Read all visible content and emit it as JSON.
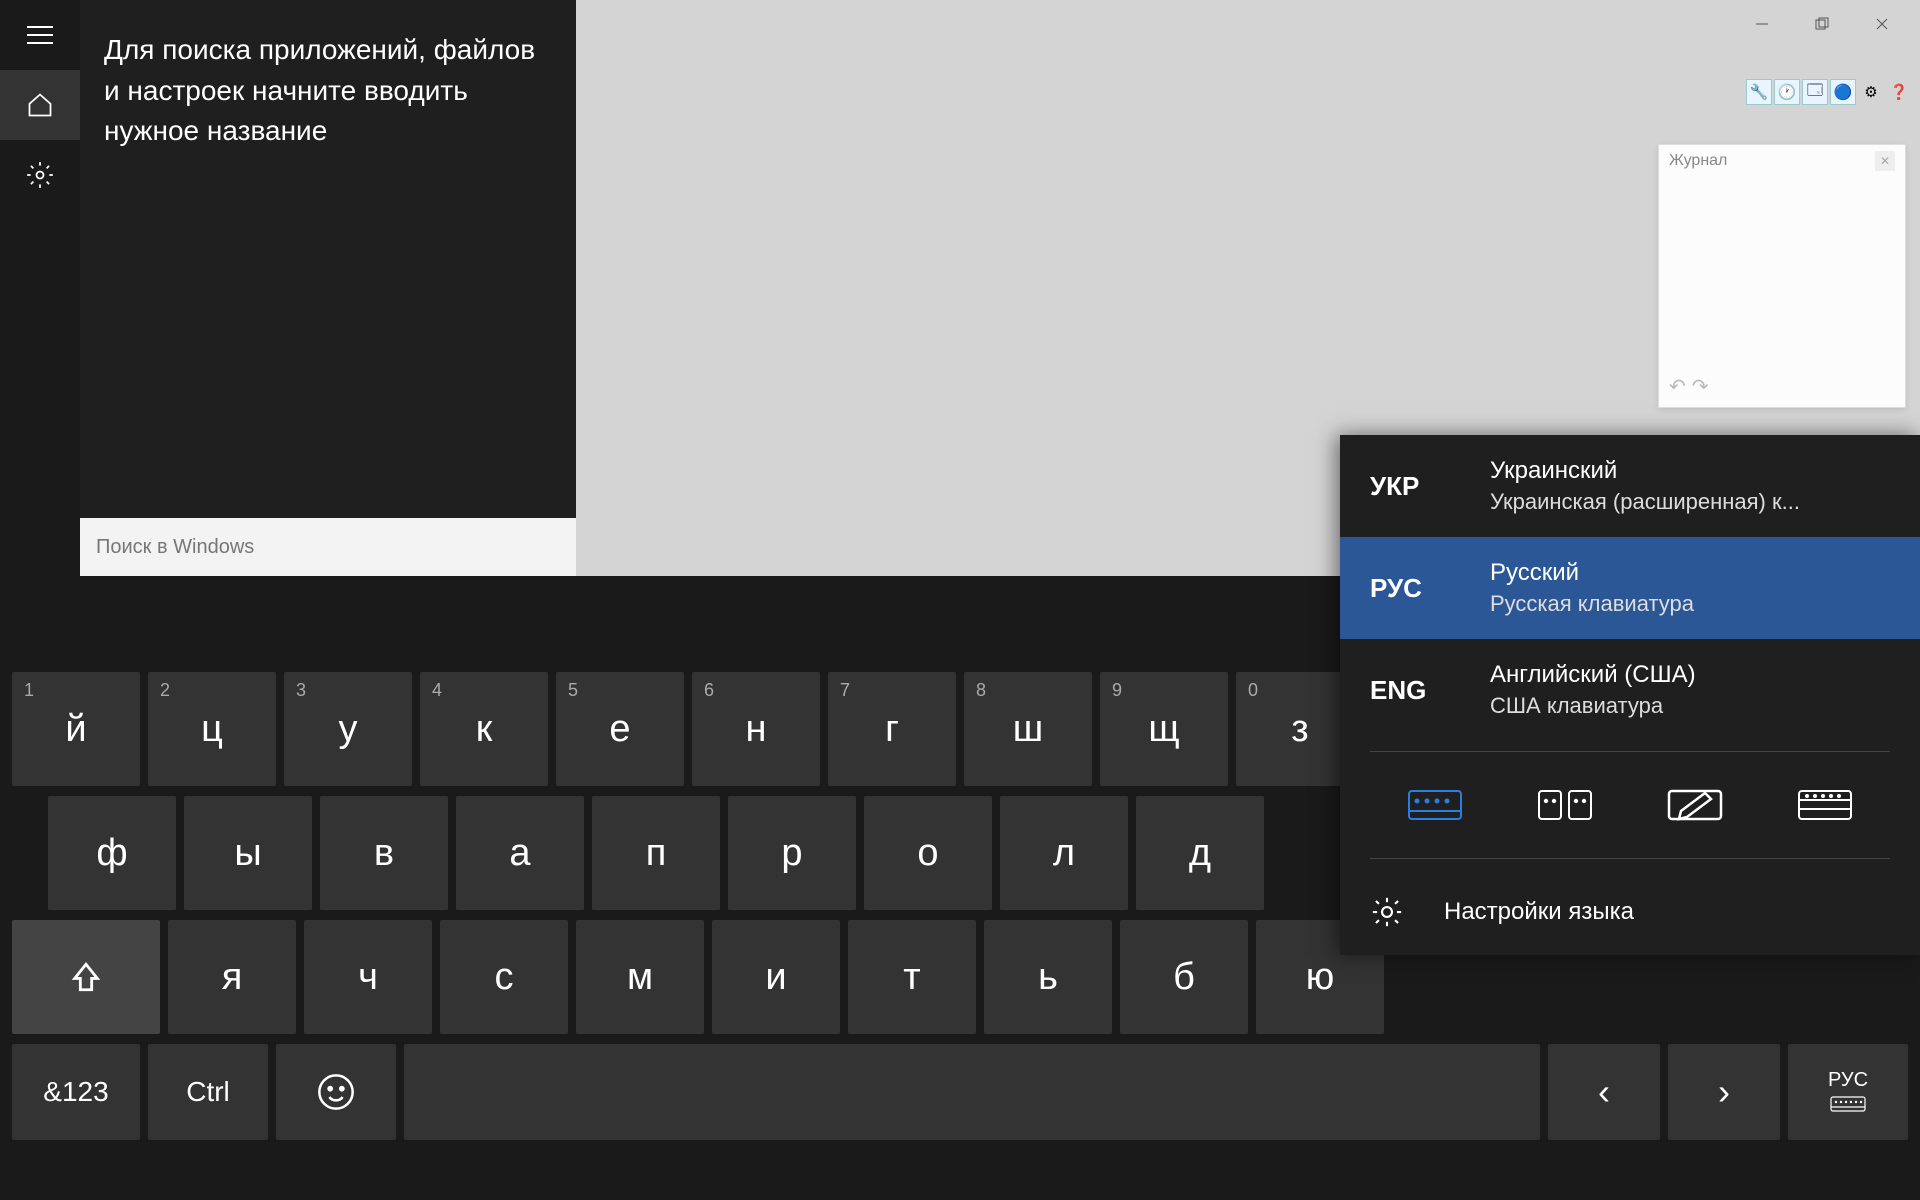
{
  "window": {
    "minimize": "—",
    "maximize": "❐",
    "close": "✕"
  },
  "toolbar": {
    "icons": [
      "🔧",
      "🕐",
      "🗂",
      "🔵",
      "⚙",
      "❓"
    ]
  },
  "history": {
    "title": "Журнал"
  },
  "search": {
    "hint": "Для поиска приложений, файлов и настроек начните вводить нужное название",
    "placeholder": "Поиск в Windows"
  },
  "keyboard": {
    "row1": [
      {
        "n": "1",
        "c": "й"
      },
      {
        "n": "2",
        "c": "ц"
      },
      {
        "n": "3",
        "c": "у"
      },
      {
        "n": "4",
        "c": "к"
      },
      {
        "n": "5",
        "c": "е"
      },
      {
        "n": "6",
        "c": "н"
      },
      {
        "n": "7",
        "c": "г"
      },
      {
        "n": "8",
        "c": "ш"
      },
      {
        "n": "9",
        "c": "щ"
      },
      {
        "n": "0",
        "c": "з"
      }
    ],
    "row2": [
      "ф",
      "ы",
      "в",
      "а",
      "п",
      "р",
      "о",
      "л",
      "д"
    ],
    "row3": [
      "я",
      "ч",
      "с",
      "м",
      "и",
      "т",
      "ь",
      "б",
      "ю"
    ],
    "sym": "&123",
    "ctrl": "Ctrl",
    "lang_short": "РУС"
  },
  "lang": {
    "items": [
      {
        "code": "УКР",
        "name": "Украинский",
        "layout": "Украинская (расширенная) к..."
      },
      {
        "code": "РУС",
        "name": "Русский",
        "layout": "Русская клавиатура"
      },
      {
        "code": "ENG",
        "name": "Английский (США)",
        "layout": "США клавиатура"
      }
    ],
    "settings": "Настройки языка"
  }
}
